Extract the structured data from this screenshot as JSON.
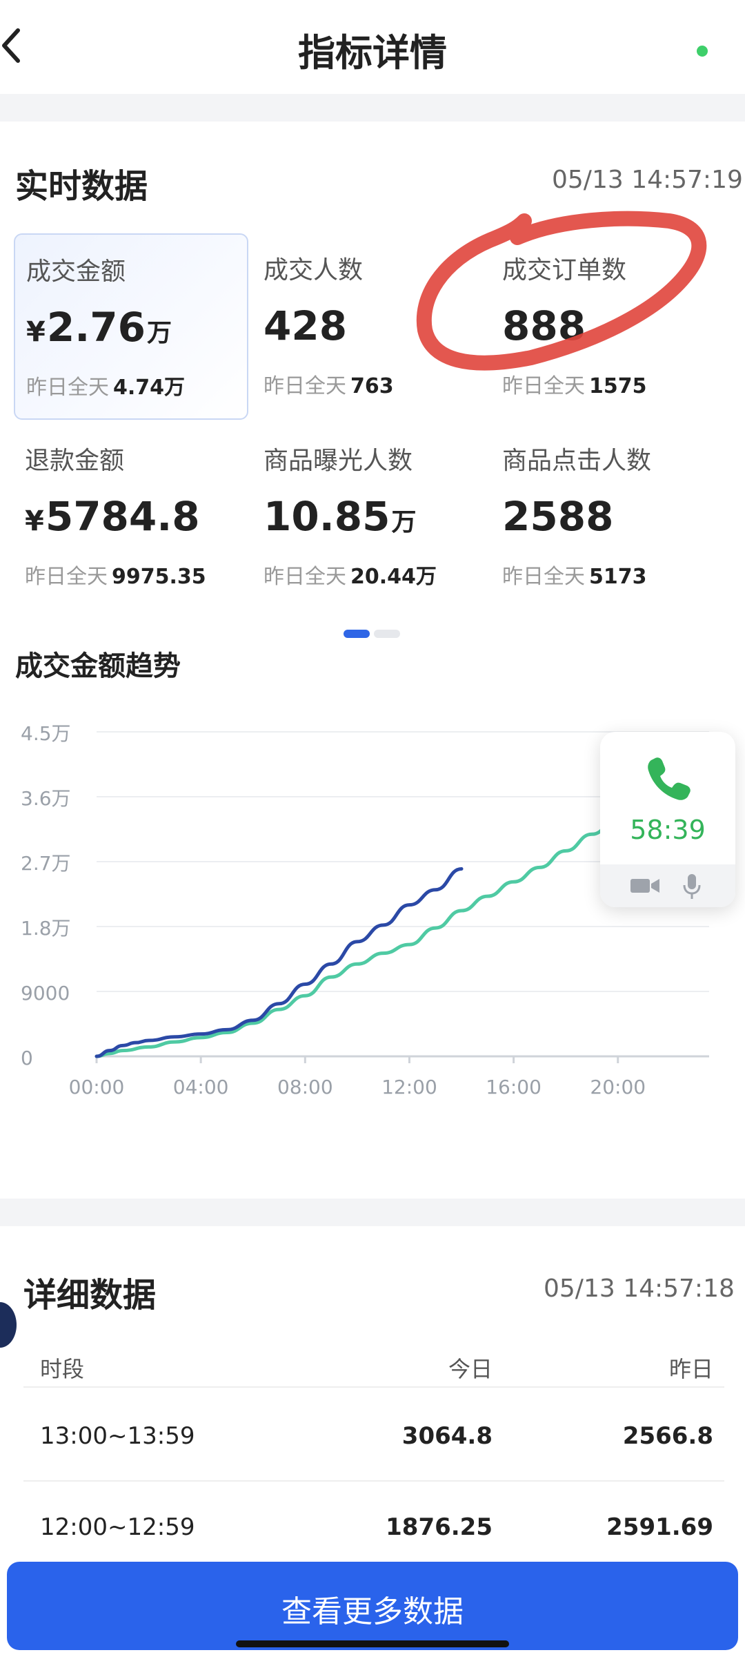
{
  "header": {
    "title": "指标详情",
    "accent": "#3ecf6a"
  },
  "realtime": {
    "title": "实时数据",
    "timestamp": "05/13 14:57:19",
    "metrics": [
      {
        "label": "成交金额",
        "currency": "¥",
        "value": "2.76",
        "unit": "万",
        "sub_label": "昨日全天",
        "sub_value": "4.74万",
        "selected": true
      },
      {
        "label": "成交人数",
        "value": "428",
        "sub_label": "昨日全天",
        "sub_value": "763"
      },
      {
        "label": "成交订单数",
        "value": "888",
        "sub_label": "昨日全天",
        "sub_value": "1575"
      },
      {
        "label": "退款金额",
        "currency": "¥",
        "value": "5784.8",
        "sub_label": "昨日全天",
        "sub_value": "9975.35"
      },
      {
        "label": "商品曝光人数",
        "value": "10.85",
        "unit": "万",
        "sub_label": "昨日全天",
        "sub_value": "20.44万"
      },
      {
        "label": "商品点击人数",
        "value": "2588",
        "sub_label": "昨日全天",
        "sub_value": "5173"
      }
    ],
    "pager": {
      "pages": 2,
      "active": 1
    }
  },
  "call_widget": {
    "duration": "58:39",
    "icons": [
      "phone-icon",
      "video-icon",
      "mic-icon"
    ],
    "color": "#34b45a"
  },
  "chart_data": {
    "type": "line",
    "title": "成交金额趋势",
    "xlabel": "",
    "ylabel": "",
    "x_ticks": [
      "00:00",
      "04:00",
      "08:00",
      "12:00",
      "16:00",
      "20:00"
    ],
    "y_ticks": [
      "0",
      "9000",
      "1.8万",
      "2.7万",
      "3.6万",
      "4.5万"
    ],
    "xlim": [
      0,
      23.5
    ],
    "ylim": [
      0,
      45000
    ],
    "grid": true,
    "series": [
      {
        "color": "#2b49a6",
        "x": [
          0,
          0.5,
          1,
          1.5,
          2,
          3,
          4,
          5,
          6,
          7,
          8,
          9,
          10,
          11,
          12,
          13,
          14
        ],
        "values": [
          0,
          800,
          1500,
          1900,
          2200,
          2700,
          3100,
          3700,
          5000,
          7300,
          10000,
          12800,
          15900,
          18200,
          21000,
          23100,
          26000
        ]
      },
      {
        "color": "#4fcaa3",
        "x": [
          0,
          0.5,
          1,
          2,
          3,
          4,
          5,
          6,
          7,
          8,
          9,
          10,
          11,
          12,
          13,
          14,
          15,
          16,
          17,
          18,
          19,
          20,
          21,
          22,
          23
        ],
        "values": [
          0,
          400,
          800,
          1300,
          2000,
          2600,
          3300,
          4600,
          6500,
          8400,
          11000,
          12800,
          14300,
          15500,
          17800,
          20200,
          22200,
          24200,
          26200,
          28500,
          30800,
          33000,
          35200,
          37500,
          39500
        ]
      }
    ]
  },
  "detail": {
    "title": "详细数据",
    "timestamp": "05/13 14:57:18",
    "columns": [
      "时段",
      "今日",
      "昨日"
    ],
    "rows": [
      [
        "13:00~13:59",
        "3064.8",
        "2566.8"
      ],
      [
        "12:00~12:59",
        "1876.25",
        "2591.69"
      ]
    ]
  },
  "cta": {
    "label": "查看更多数据",
    "color": "#2a63eb"
  },
  "annotation": {
    "color": "#e0453c"
  }
}
